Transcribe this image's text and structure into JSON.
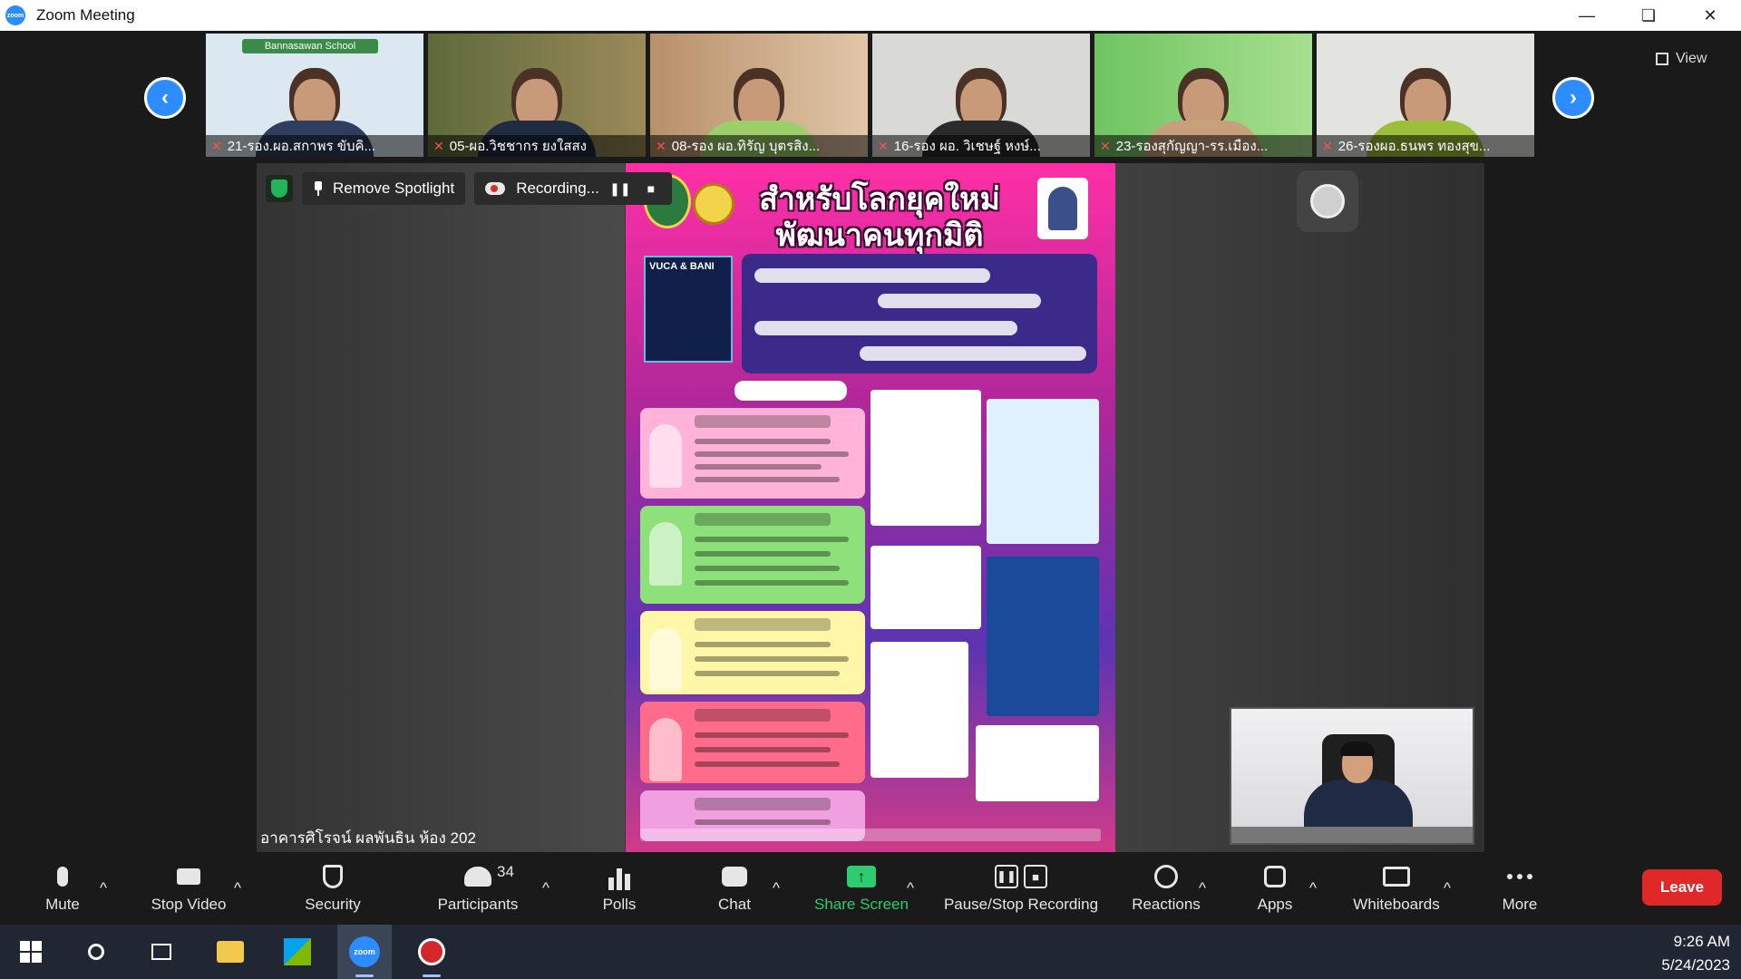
{
  "window": {
    "title": "Zoom Meeting",
    "controls": [
      "minimize",
      "restore",
      "close"
    ]
  },
  "gallery": {
    "view_label": "View",
    "participants": [
      {
        "name": "21-รอง.ผอ.สกาพร ขับคิ...",
        "banner": "Bannasawan School",
        "mic": "muted",
        "bg": "#dbe8f2"
      },
      {
        "name": "05-ผอ.วิชชากร ยงใสสง",
        "mic": "muted",
        "bg": "#7b7a52"
      },
      {
        "name": "08-รอง ผอ.ทิรัญ บุตรสิง...",
        "mic": "muted",
        "bg": "#caa98a"
      },
      {
        "name": "16-รอง ผอ. วิเชษฐ์ หงษ์...",
        "mic": "muted",
        "bg": "#d9d9d6"
      },
      {
        "name": "23-รองสุกัญญา-รร.เมือง...",
        "mic": "muted",
        "bg": "#8fd07a"
      },
      {
        "name": "26-รองผอ.ธนพร ทองสุข...",
        "mic": "muted",
        "bg": "#e3e3e0"
      }
    ]
  },
  "spotlight": {
    "remove_label": "Remove Spotlight",
    "recording_label": "Recording...",
    "location_label": "อาคารศิโรจน์ ผลพันธิน ห้อง 202"
  },
  "shared_poster": {
    "title": "สำหรับโลกยุคใหม่ พัฒนาคนทุกมิติ",
    "vuca_label": "VUCA & BANI"
  },
  "toolbar": {
    "mute": "Mute",
    "stop_video": "Stop Video",
    "security": "Security",
    "participants": "Participants",
    "participant_count": "34",
    "polls": "Polls",
    "chat": "Chat",
    "share_screen": "Share Screen",
    "pause_stop_recording": "Pause/Stop Recording",
    "reactions": "Reactions",
    "apps": "Apps",
    "whiteboards": "Whiteboards",
    "more": "More",
    "leave": "Leave"
  },
  "taskbar": {
    "time": "9:26 AM",
    "date": "5/24/2023"
  },
  "colors": {
    "zoom_blue": "#2d8cff",
    "leave_red": "#e02828",
    "share_green": "#2ecc71",
    "muted_red": "#ff4d4d"
  }
}
